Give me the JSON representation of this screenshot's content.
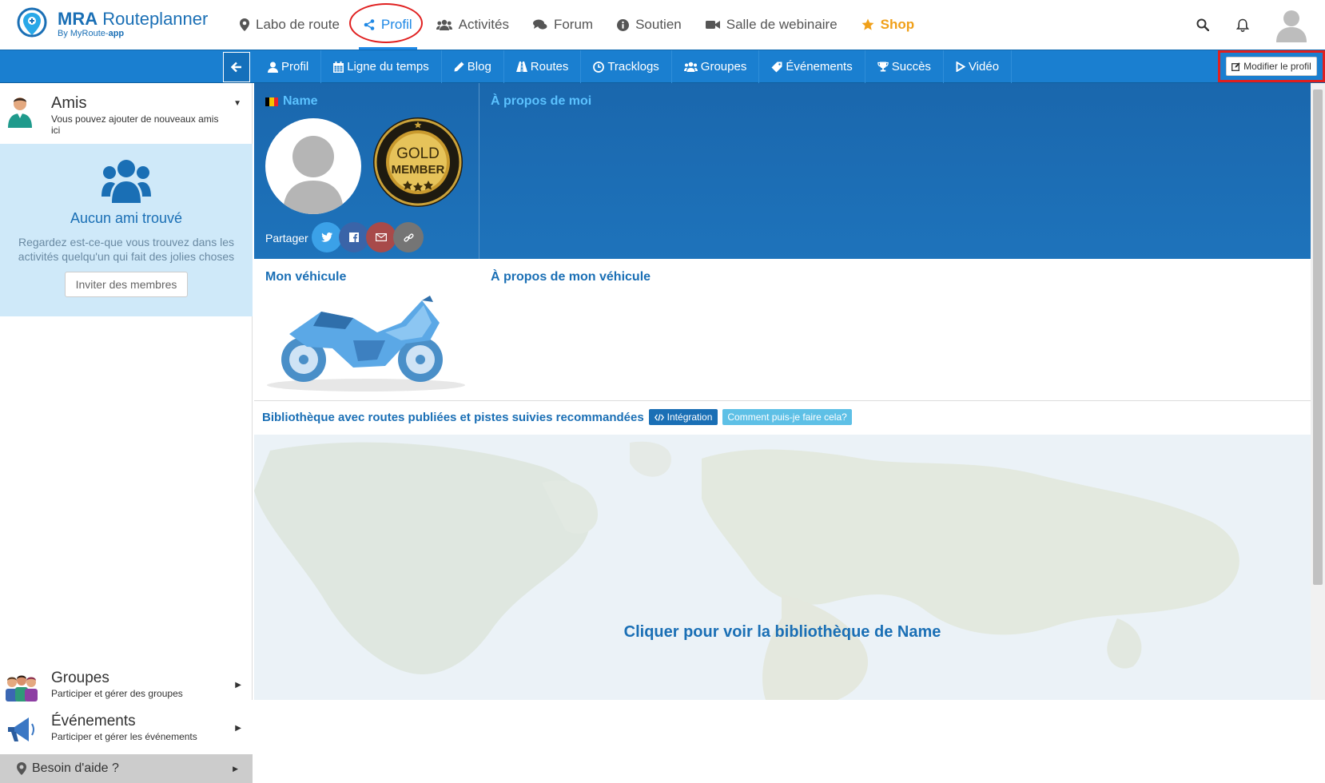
{
  "app": {
    "brand_bold": "MRA",
    "brand_rest": "Routeplanner",
    "brand_sub_prefix": "By MyRoute-",
    "brand_sub_bold": "app"
  },
  "topnav": {
    "items": [
      {
        "label": "Labo de route",
        "icon": "map-pin-icon"
      },
      {
        "label": "Profil",
        "icon": "share-icon",
        "active": true
      },
      {
        "label": "Activités",
        "icon": "users-icon"
      },
      {
        "label": "Forum",
        "icon": "comments-icon"
      },
      {
        "label": "Soutien",
        "icon": "info-icon"
      },
      {
        "label": "Salle de webinaire",
        "icon": "video-camera-icon"
      },
      {
        "label": "Shop",
        "icon": "star-icon"
      }
    ]
  },
  "subnav": {
    "tabs": [
      {
        "label": "Profil",
        "icon": "user-icon"
      },
      {
        "label": "Ligne du temps",
        "icon": "calendar-icon"
      },
      {
        "label": "Blog",
        "icon": "pencil-icon"
      },
      {
        "label": "Routes",
        "icon": "road-icon"
      },
      {
        "label": "Tracklogs",
        "icon": "clock-icon"
      },
      {
        "label": "Groupes",
        "icon": "users-icon"
      },
      {
        "label": "Événements",
        "icon": "tag-icon"
      },
      {
        "label": "Succès",
        "icon": "trophy-icon"
      },
      {
        "label": "Vidéo",
        "icon": "play-icon"
      }
    ],
    "edit_profile": "Modifier le profil"
  },
  "sidebar": {
    "amis_title": "Amis",
    "amis_desc": "Vous pouvez ajouter de nouveaux amis ici",
    "no_friends_title": "Aucun ami trouvé",
    "no_friends_text": "Regardez est-ce-que vous trouvez dans les activités quelqu'un qui fait des jolies choses",
    "invite_button": "Inviter des membres",
    "groupes_title": "Groupes",
    "groupes_desc": "Participer et gérer des groupes",
    "events_title": "Événements",
    "events_desc": "Participer et gérer les événements",
    "help": "Besoin d'aide ?"
  },
  "profile": {
    "name": "Name",
    "badge_line1": "GOLD",
    "badge_line2": "MEMBER",
    "share_label": "Partager",
    "about_title": "À propos de moi",
    "vehicle_title": "Mon véhicule",
    "vehicle_about_title": "À propos de mon véhicule"
  },
  "library": {
    "title": "Bibliothèque avec routes publiées et pistes suivies recommandées",
    "integration_button": "Intégration",
    "how_button": "Comment puis-je faire cela?",
    "cta": "Cliquer pour voir la bibliothèque de Name"
  },
  "colors": {
    "brand_blue": "#1a6fb5",
    "nav_active": "#1e88e5",
    "shop_orange": "#f0a019",
    "annotation_red": "#e02020"
  }
}
